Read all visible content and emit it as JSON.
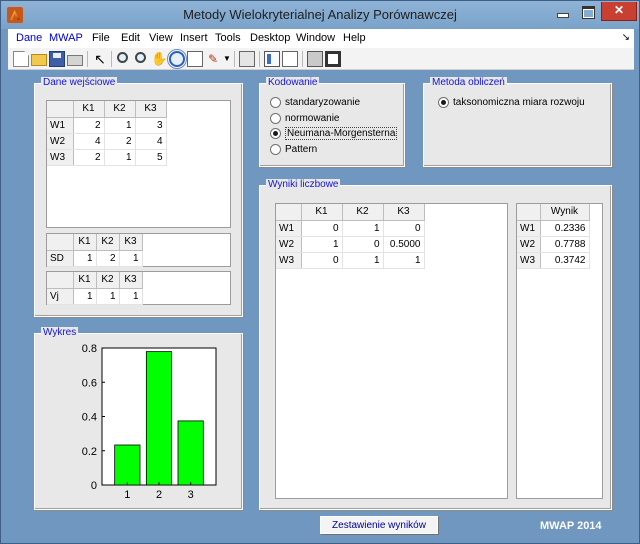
{
  "window": {
    "title": "Metody Wielokryterialnej Analizy Porównawczej"
  },
  "menu": {
    "items": [
      "Dane",
      "MWAP",
      "File",
      "Edit",
      "View",
      "Insert",
      "Tools",
      "Desktop",
      "Window",
      "Help"
    ],
    "corner": "↘"
  },
  "input_panel": {
    "title": "Dane wejściowe",
    "columns": [
      "",
      "K1",
      "K2",
      "K3"
    ],
    "rows": [
      {
        "label": "W1",
        "values": [
          "2",
          "1",
          "3"
        ]
      },
      {
        "label": "W2",
        "values": [
          "4",
          "2",
          "4"
        ]
      },
      {
        "label": "W3",
        "values": [
          "2",
          "1",
          "5"
        ]
      }
    ],
    "sd": {
      "columns": [
        "",
        "K1",
        "K2",
        "K3"
      ],
      "label": "SD",
      "values": [
        "1",
        "2",
        "1"
      ]
    },
    "vj": {
      "columns": [
        "",
        "K1",
        "K2",
        "K3"
      ],
      "label": "Vj",
      "values": [
        "1",
        "1",
        "1"
      ]
    }
  },
  "coding_panel": {
    "title": "Kodowanie",
    "options": [
      "standaryzowanie",
      "normowanie",
      "Neumana-Morgensterna",
      "Pattern"
    ],
    "selected_index": 2
  },
  "method_panel": {
    "title": "Metoda obliczeń",
    "options": [
      "taksonomiczna miara rozwoju"
    ],
    "selected_index": 0
  },
  "results_panel": {
    "title": "Wyniki liczbowe",
    "columns": [
      "",
      "K1",
      "K2",
      "K3"
    ],
    "rows": [
      {
        "label": "W1",
        "values": [
          "0",
          "1",
          "0"
        ]
      },
      {
        "label": "W2",
        "values": [
          "1",
          "0",
          "0.5000"
        ]
      },
      {
        "label": "W3",
        "values": [
          "0",
          "1",
          "1"
        ]
      }
    ],
    "score_columns": [
      "",
      "Wynik"
    ],
    "scores": [
      {
        "label": "W1",
        "value": "0.2336"
      },
      {
        "label": "W2",
        "value": "0.7788"
      },
      {
        "label": "W3",
        "value": "0.3742"
      }
    ]
  },
  "chart_panel": {
    "title": "Wykres"
  },
  "chart_data": {
    "type": "bar",
    "categories": [
      "1",
      "2",
      "3"
    ],
    "values": [
      0.2336,
      0.7788,
      0.3742
    ],
    "ylim": [
      0,
      0.8
    ],
    "yticks": [
      "0",
      "0.2",
      "0.4",
      "0.6",
      "0.8"
    ],
    "bar_color": "#00ff00",
    "grid": false
  },
  "footer": {
    "summary_button": "Zestawienie wyników",
    "brand": "MWAP  2014"
  },
  "colors": {
    "accent_text": "#1515d6",
    "background": "#6f97bf",
    "panel": "#e8e8e8"
  }
}
